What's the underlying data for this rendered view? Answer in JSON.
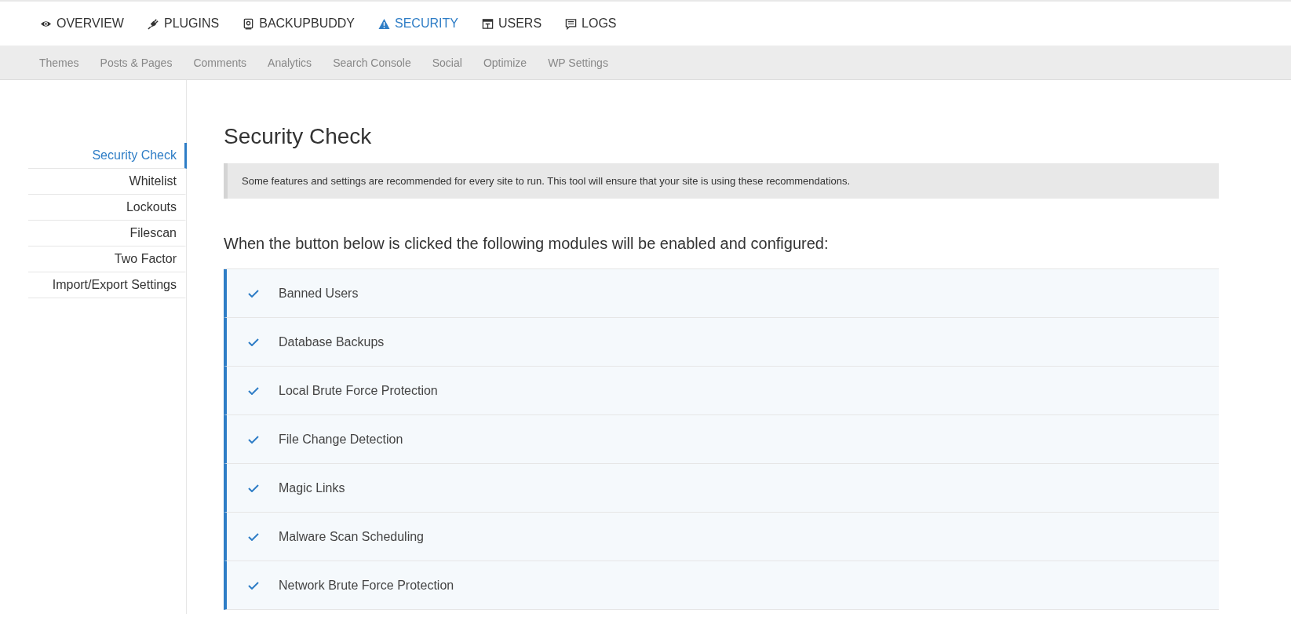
{
  "main_nav": [
    {
      "label": "OVERVIEW",
      "selected": false
    },
    {
      "label": "PLUGINS",
      "selected": false
    },
    {
      "label": "BACKUPBUDDY",
      "selected": false
    },
    {
      "label": "SECURITY",
      "selected": true
    },
    {
      "label": "USERS",
      "selected": false
    },
    {
      "label": "LOGS",
      "selected": false
    }
  ],
  "sub_nav": [
    "Themes",
    "Posts & Pages",
    "Comments",
    "Analytics",
    "Search Console",
    "Social",
    "Optimize",
    "WP Settings"
  ],
  "sidebar": {
    "items": [
      {
        "label": "Security Check",
        "selected": true
      },
      {
        "label": "Whitelist",
        "selected": false
      },
      {
        "label": "Lockouts",
        "selected": false
      },
      {
        "label": "Filescan",
        "selected": false
      },
      {
        "label": "Two Factor",
        "selected": false
      },
      {
        "label": "Import/Export Settings",
        "selected": false
      }
    ]
  },
  "page": {
    "title": "Security Check",
    "notice": "Some features and settings are recommended for every site to run. This tool will ensure that your site is using these recommendations.",
    "subtitle": "When the button below is clicked the following modules will be enabled and configured:",
    "modules": [
      {
        "label": "Banned Users",
        "checked": true
      },
      {
        "label": "Database Backups",
        "checked": true
      },
      {
        "label": "Local Brute Force Protection",
        "checked": true
      },
      {
        "label": "File Change Detection",
        "checked": true
      },
      {
        "label": "Magic Links",
        "checked": true
      },
      {
        "label": "Malware Scan Scheduling",
        "checked": true
      },
      {
        "label": "Network Brute Force Protection",
        "checked": true
      }
    ]
  }
}
